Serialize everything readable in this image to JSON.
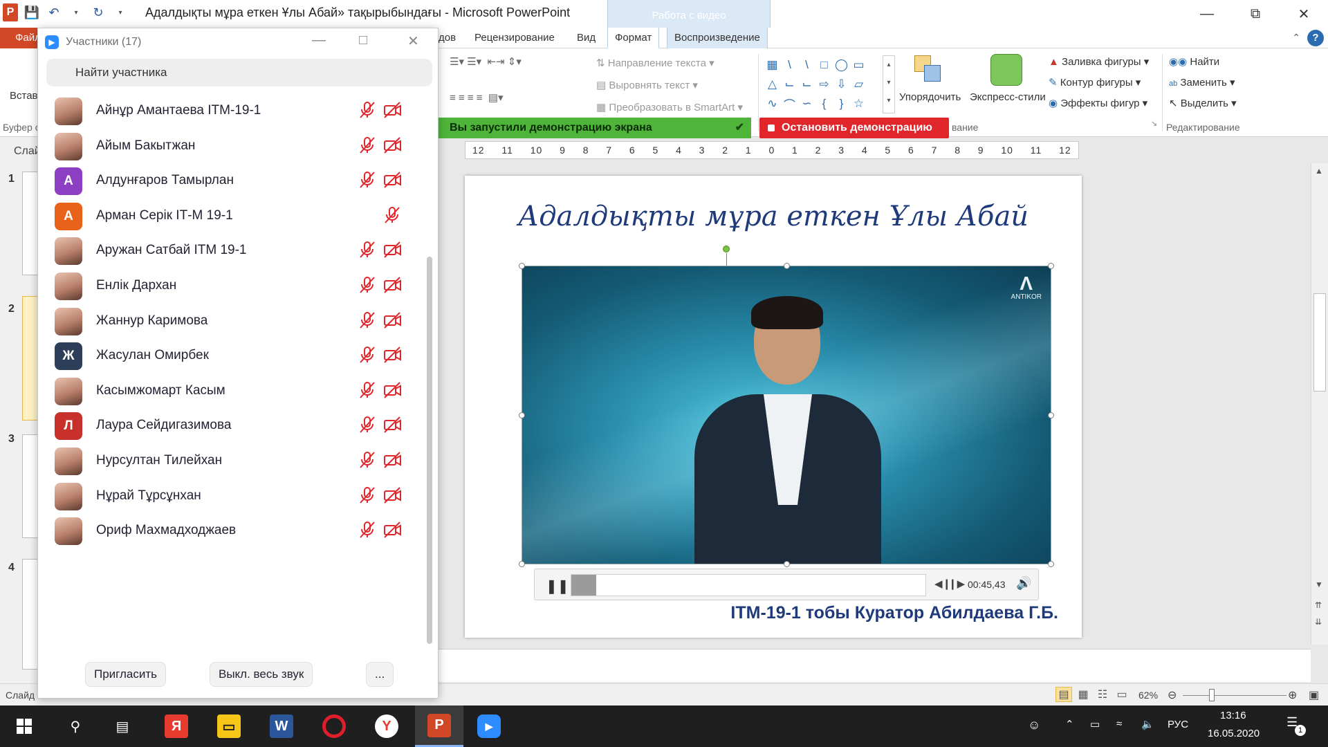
{
  "window": {
    "title": "Адалдықты мұра еткен Ұлы Абай» тақырыбындағы - Microsoft PowerPoint",
    "contextual_group": "Работа с видео"
  },
  "ribbon": {
    "tabs": [
      {
        "label": "Файл",
        "type": "file"
      },
      {
        "label": "дов"
      },
      {
        "label": "Рецензирование"
      },
      {
        "label": "Вид"
      },
      {
        "label": "Формат",
        "type": "ctx"
      },
      {
        "label": "Воспроизведение",
        "type": "ctx"
      }
    ],
    "paste_label": "Встав",
    "clipboard_label": "Буфер о",
    "text_direction": "Направление текста",
    "align_text": "Выровнять текст",
    "convert_smartart": "Преобразовать в SmartArt",
    "arrange": "Упорядочить",
    "quick_styles": "Экспресс-стили",
    "shape_fill": "Заливка фигуры",
    "shape_outline": "Контур фигуры",
    "shape_effects": "Эффекты фигур",
    "find": "Найти",
    "replace": "Заменить",
    "select": "Выделить",
    "drawing_group_fragment": "вание",
    "editing_group": "Редактирование"
  },
  "share_banner": {
    "message": "Вы запустили демонстрацию экрана",
    "stop_label": "Остановить демонстрацию"
  },
  "slides_panel": {
    "label": "Слай",
    "numbers": [
      "1",
      "2",
      "3",
      "4"
    ],
    "selected": "2"
  },
  "ruler": {
    "ticks": [
      "12",
      "11",
      "10",
      "9",
      "8",
      "7",
      "6",
      "5",
      "4",
      "3",
      "2",
      "1",
      "0",
      "1",
      "2",
      "3",
      "4",
      "5",
      "6",
      "7",
      "8",
      "9",
      "10",
      "11",
      "12"
    ]
  },
  "slide": {
    "title": "Адалдықты мұра еткен Ұлы Абай",
    "footer": "ІТМ-19-1 тобы  Куратор Абилдаева Г.Б.",
    "video_watermark": "ANTIKOR",
    "player": {
      "time": "00:45,43",
      "progress": 0.07
    }
  },
  "statusbar": {
    "slide_info": "Слайд",
    "zoom": "62%"
  },
  "participants": {
    "title": "Участники (17)",
    "search_placeholder": "Найти участника",
    "items": [
      {
        "name": "Айнұр Амантаева ІТМ-19-1",
        "avatar": "photo",
        "mic_muted": true,
        "video_off": true
      },
      {
        "name": "Айым Бакытжан",
        "avatar": "photo",
        "mic_muted": true,
        "video_off": true
      },
      {
        "name": "Алдунғаров Тамырлан",
        "avatar": "А",
        "avatar_color": "#8c3fc2",
        "mic_muted": true,
        "video_off": true
      },
      {
        "name": "Арман Серік ІТ-М 19-1",
        "avatar": "А",
        "avatar_color": "#e8621a",
        "mic_muted": true,
        "video_off": false
      },
      {
        "name": "Аружан Сатбай ІТМ 19-1",
        "avatar": "photo",
        "mic_muted": true,
        "video_off": true
      },
      {
        "name": "Енлік Дархан",
        "avatar": "photo",
        "mic_muted": true,
        "video_off": true
      },
      {
        "name": "Жаннур Каримова",
        "avatar": "photo",
        "mic_muted": true,
        "video_off": true
      },
      {
        "name": "Жасулан Омирбек",
        "avatar": "Ж",
        "avatar_color": "#2c3e58",
        "mic_muted": true,
        "video_off": true
      },
      {
        "name": "Касымжомарт Касым",
        "avatar": "photo",
        "mic_muted": true,
        "video_off": true
      },
      {
        "name": "Лаура Сейдигазимова",
        "avatar": "Л",
        "avatar_color": "#c8302c",
        "mic_muted": true,
        "video_off": true
      },
      {
        "name": "Нурсултан Тилейхан",
        "avatar": "photo",
        "mic_muted": true,
        "video_off": true
      },
      {
        "name": "Нұрай Тұрсұнхан",
        "avatar": "photo",
        "mic_muted": true,
        "video_off": true
      },
      {
        "name": "Ориф Махмадходжаев",
        "avatar": "photo",
        "mic_muted": true,
        "video_off": true
      }
    ],
    "footer": {
      "invite": "Пригласить",
      "mute_all": "Выкл. весь звук",
      "more": "..."
    }
  },
  "taskbar": {
    "language": "РУС",
    "time": "13:16",
    "date": "16.05.2020",
    "notifications": "1",
    "apps": [
      "windows-start",
      "search",
      "task-view",
      "yandex",
      "file-explorer",
      "word",
      "opera",
      "yandex-browser",
      "powerpoint",
      "zoom"
    ],
    "active_app": "powerpoint"
  },
  "colors": {
    "ppt_accent": "#d24726",
    "zoom_blue": "#2d8cff",
    "muted_red": "#e0262b",
    "share_green": "#4fb53a",
    "slide_title": "#1f3a7a"
  }
}
